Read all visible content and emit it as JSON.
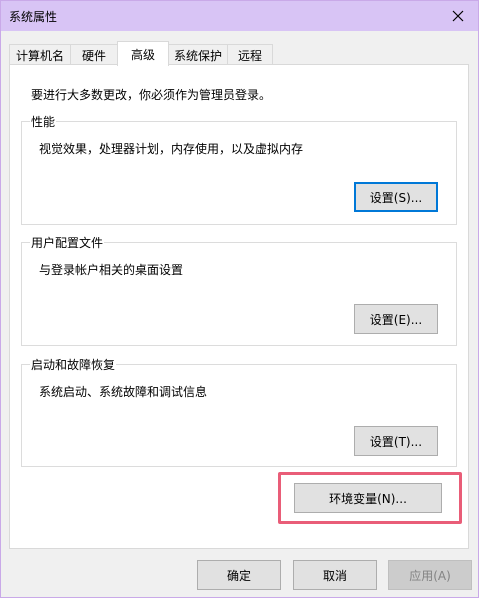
{
  "window": {
    "title": "系统属性"
  },
  "tabs": [
    {
      "label": "计算机名",
      "active": false
    },
    {
      "label": "硬件",
      "active": false
    },
    {
      "label": "高级",
      "active": true
    },
    {
      "label": "系统保护",
      "active": false
    },
    {
      "label": "远程",
      "active": false
    }
  ],
  "advanced": {
    "admin_note": "要进行大多数更改，你必须作为管理员登录。",
    "performance": {
      "title": "性能",
      "description": "视觉效果，处理器计划，内存使用，以及虚拟内存",
      "button": "设置(S)..."
    },
    "user_profiles": {
      "title": "用户配置文件",
      "description": "与登录帐户相关的桌面设置",
      "button": "设置(E)..."
    },
    "startup_recovery": {
      "title": "启动和故障恢复",
      "description": "系统启动、系统故障和调试信息",
      "button": "设置(T)..."
    },
    "env_button": "环境变量(N)..."
  },
  "footer": {
    "ok": "确定",
    "cancel": "取消",
    "apply": "应用(A)"
  },
  "colors": {
    "titlebar": "#d8c4f5",
    "accent": "#0078d7",
    "highlight": "#e95d78"
  },
  "icons": {
    "close": "close-icon"
  }
}
